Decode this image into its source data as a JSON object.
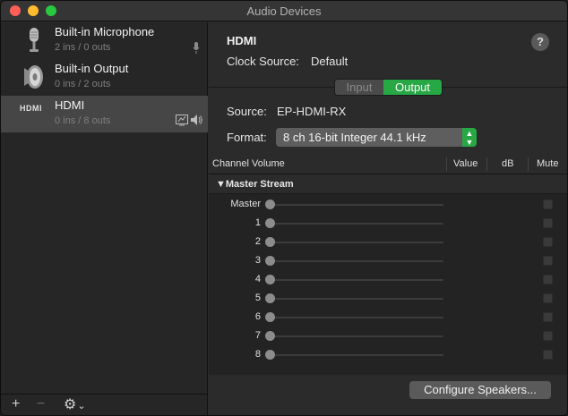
{
  "window": {
    "title": "Audio Devices"
  },
  "devices": [
    {
      "name": "Built-in Microphone",
      "io": "2 ins / 0 outs",
      "icon": "microphone-icon"
    },
    {
      "name": "Built-in Output",
      "io": "0 ins / 2 outs",
      "icon": "speaker-icon"
    },
    {
      "name": "HDMI",
      "io": "0 ins / 8 outs",
      "icon": "hdmi-icon",
      "icon_text": "HDMI",
      "selected": true
    }
  ],
  "sidebar_bottom": {
    "add": "+",
    "remove": "−",
    "gear": "⚙︎",
    "gear_arrow": "⌄"
  },
  "detail": {
    "title": "HDMI",
    "help": "?",
    "clock_label": "Clock Source:",
    "clock_value": "Default",
    "tabs": {
      "input": "Input",
      "output": "Output",
      "selected": "Output"
    },
    "source_label": "Source:",
    "source_value": "EP-HDMI-RX",
    "format_label": "Format:",
    "format_value": "8 ch 16-bit Integer 44.1 kHz"
  },
  "table": {
    "headers": {
      "channel_volume": "Channel Volume",
      "value": "Value",
      "db": "dB",
      "mute": "Mute"
    },
    "stream": "▼Master Stream",
    "channels": [
      "Master",
      "1",
      "2",
      "3",
      "4",
      "5",
      "6",
      "7",
      "8"
    ]
  },
  "configure_button": "Configure Speakers...",
  "colors": {
    "accent": "#28a745",
    "background": "#2b2b2b",
    "sidebar": "#262626",
    "selected_row": "#464646"
  }
}
